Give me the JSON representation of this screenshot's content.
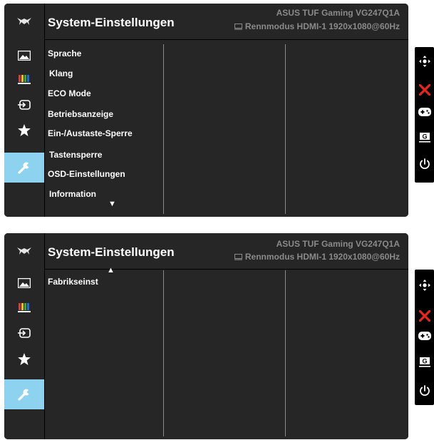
{
  "screens": [
    {
      "header": {
        "title": "System-Einstellungen",
        "model": "ASUS TUF Gaming VG247Q1A",
        "mode": "Rennmodus HDMI-1 1920x1080@60Hz"
      },
      "menu_items": [
        "Sprache",
        "Klang",
        "ECO Mode",
        "Betriebsanzeige",
        "Ein-/Austaste-Sperre",
        "Tastensperre",
        "OSD-Einstellungen",
        "Information"
      ],
      "scroll_indicator": "down"
    },
    {
      "header": {
        "title": "System-Einstellungen",
        "model": "ASUS TUF Gaming VG247Q1A",
        "mode": "Rennmodus HDMI-1 1920x1080@60Hz"
      },
      "menu_items": [
        "Fabrikseinst"
      ],
      "scroll_indicator": "up"
    }
  ],
  "sidebar_icons": [
    "image-icon",
    "color-icon",
    "input-icon",
    "favorite-icon",
    "settings-icon"
  ],
  "active_sidebar": "settings-icon",
  "controls": [
    "joystick-icon",
    "close-icon",
    "gamevisual-icon",
    "gameplus-icon",
    "power-icon"
  ],
  "colors": {
    "panel": "#000000",
    "surface": "#262626",
    "active": "#8dd3ef",
    "text": "#ffffff",
    "muted": "#8a8a8a",
    "close": "#e8261b"
  }
}
